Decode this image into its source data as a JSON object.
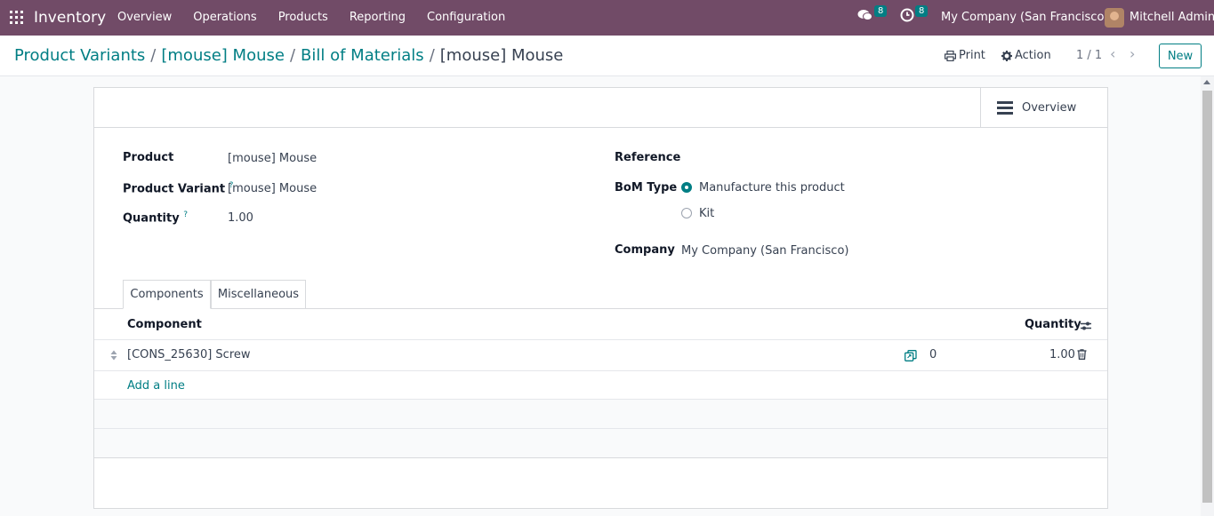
{
  "navbar": {
    "app_name": "Inventory",
    "menu": [
      "Overview",
      "Operations",
      "Products",
      "Reporting",
      "Configuration"
    ],
    "messages_count": "8",
    "activities_count": "8",
    "company": "My Company (San Francisco)",
    "user": "Mitchell Admin"
  },
  "control_panel": {
    "breadcrumbs": [
      "Product Variants",
      "[mouse] Mouse",
      "Bill of Materials"
    ],
    "current": "[mouse] Mouse",
    "print_label": "Print",
    "action_label": "Action",
    "pager": "1 / 1",
    "new_label": "New"
  },
  "form": {
    "overview_label": "Overview",
    "product_label": "Product",
    "product_value": "[mouse] Mouse",
    "variant_label": "Product Variant",
    "variant_value": "[mouse] Mouse",
    "quantity_label": "Quantity",
    "quantity_value": "1.00",
    "reference_label": "Reference",
    "bom_type_label": "BoM Type",
    "bom_type_options": [
      "Manufacture this product",
      "Kit"
    ],
    "bom_type_selected": "Manufacture this product",
    "company_label": "Company",
    "company_value": "My Company (San Francisco)",
    "help_mark": "?"
  },
  "tabs": [
    "Components",
    "Miscellaneous"
  ],
  "components_table": {
    "columns": [
      "Component",
      "Quantity"
    ],
    "rows": [
      {
        "component": "[CONS_25630] Screw",
        "forecast": "0",
        "quantity": "1.00"
      }
    ],
    "add_line": "Add a line"
  },
  "colors": {
    "navbar": "#714b67",
    "accent": "#017e84"
  }
}
